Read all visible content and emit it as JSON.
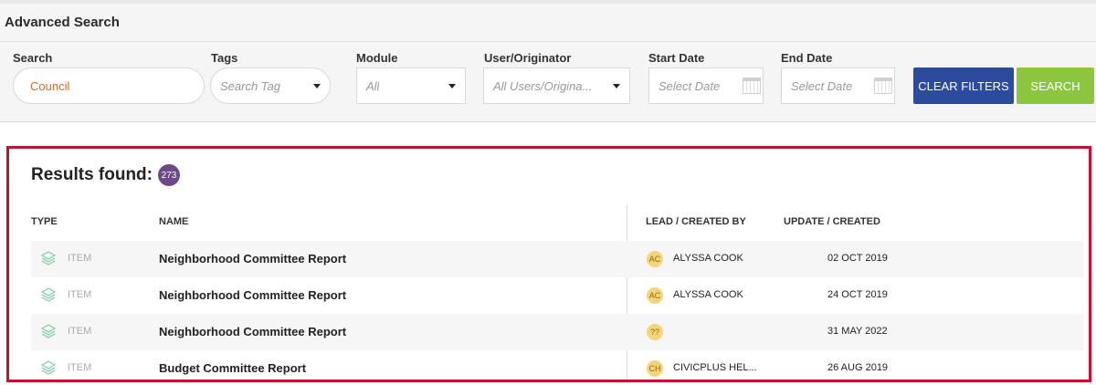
{
  "header": {
    "title": "Advanced Search"
  },
  "filters": {
    "search": {
      "label": "Search",
      "value": "Council"
    },
    "tags": {
      "label": "Tags",
      "placeholder": "Search Tag"
    },
    "module": {
      "label": "Module",
      "value": "All"
    },
    "user": {
      "label": "User/Originator",
      "value": "All Users/Origina..."
    },
    "start_date": {
      "label": "Start Date",
      "placeholder": "Select Date"
    },
    "end_date": {
      "label": "End Date",
      "placeholder": "Select Date"
    },
    "clear_label": "CLEAR FILTERS",
    "search_label": "SEARCH"
  },
  "results": {
    "title": "Results found:",
    "count": "273",
    "columns": {
      "type": "TYPE",
      "name": "NAME",
      "lead": "LEAD / CREATED BY",
      "updated": "UPDATE / CREATED"
    },
    "rows": [
      {
        "type": "ITEM",
        "name": "Neighborhood Committee Report",
        "initials": "AC",
        "lead": "ALYSSA COOK",
        "date": "02 OCT 2019"
      },
      {
        "type": "ITEM",
        "name": "Neighborhood Committee Report",
        "initials": "AC",
        "lead": "ALYSSA COOK",
        "date": "24 OCT 2019"
      },
      {
        "type": "ITEM",
        "name": "Neighborhood Committee Report",
        "initials": "??",
        "lead": "",
        "date": "31 MAY 2022"
      },
      {
        "type": "ITEM",
        "name": "Budget Committee Report",
        "initials": "CH",
        "lead": "CIVICPLUS HEL...",
        "date": "26 AUG 2019"
      }
    ]
  },
  "colors": {
    "clear_button": "#2c4a9e",
    "search_button": "#8cc63f",
    "badge": "#6b4a8a",
    "highlight_border": "#c8102e",
    "avatar": "#f6d57a"
  },
  "icons": {
    "type_icon": "layers-icon",
    "calendar": "calendar-icon",
    "dropdown": "caret-down-icon"
  }
}
